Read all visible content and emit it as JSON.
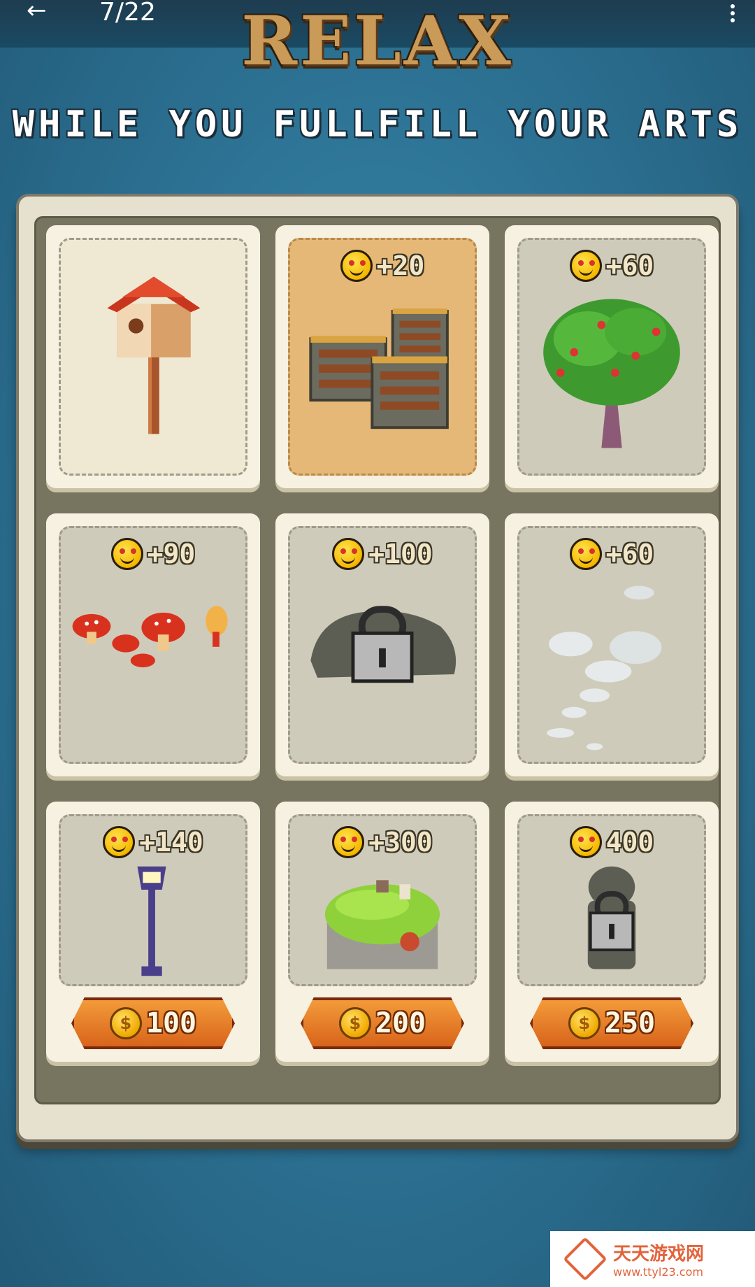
{
  "topbar": {
    "back_icon": "arrow-left-icon",
    "counter": "7/22",
    "menu_icon": "more-vert-icon"
  },
  "header": {
    "title": "RELAX",
    "subtitle": "WHILE YOU FULLFILL YOUR ARTS"
  },
  "cards": [
    {
      "item": "birdhouse",
      "reward": ""
    },
    {
      "item": "crates",
      "reward": "+20"
    },
    {
      "item": "apple-tree",
      "reward": "+60"
    },
    {
      "item": "mushrooms",
      "reward": "+90"
    },
    {
      "item": "locked-bush",
      "reward": "+100",
      "locked": true
    },
    {
      "item": "stones",
      "reward": "+60"
    },
    {
      "item": "street-lamp",
      "reward": "+140",
      "price": "100"
    },
    {
      "item": "hobbit-house",
      "reward": "+300",
      "price": "200"
    },
    {
      "item": "locked-figure",
      "reward": "400",
      "price": "250",
      "locked": true
    }
  ],
  "coin_symbol": "$",
  "watermark": {
    "name": "天天游戏网",
    "url": "www.ttyl23.com"
  },
  "colors": {
    "accent_orange": "#e07a22",
    "panel": "#e6e1cf",
    "background": "#2e7597"
  }
}
